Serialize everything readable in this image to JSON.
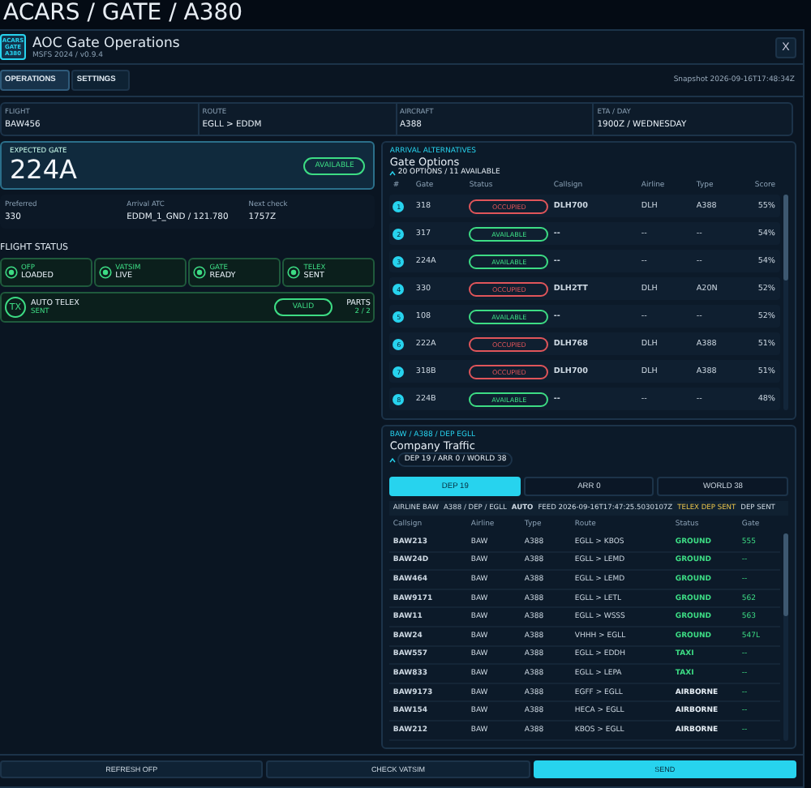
{
  "page_heading": "ACARS / GATE / A380",
  "window": {
    "logo": [
      "ACARS",
      "GATE",
      "A380"
    ],
    "title": "AOC Gate Operations",
    "subtitle": "MSFS 2024 / v0.9.4",
    "close": "X"
  },
  "tabs": [
    {
      "label": "OPERATIONS",
      "selected": true
    },
    {
      "label": "SETTINGS",
      "selected": false
    }
  ],
  "snapshot": "Snapshot 2026-09-16T17:48:34Z",
  "info": [
    {
      "label": "FLIGHT",
      "value": "BAW456"
    },
    {
      "label": "ROUTE",
      "value": "EGLL > EDDM"
    },
    {
      "label": "AIRCRAFT",
      "value": "A388"
    },
    {
      "label": "ETA / DAY",
      "value": "1900Z / WEDNESDAY"
    }
  ],
  "expected_gate": {
    "label": "EXPECTED GATE",
    "gate": "224A",
    "status": "AVAILABLE"
  },
  "details": [
    {
      "label": "Preferred",
      "value": "330"
    },
    {
      "label": "Arrival ATC",
      "value": "EDDM_1_GND / 121.780"
    },
    {
      "label": "Next check",
      "value": "1757Z"
    }
  ],
  "flight_status": {
    "title": "FLIGHT STATUS",
    "items": [
      {
        "label": "OFP",
        "value": "LOADED",
        "ok": true
      },
      {
        "label": "VATSIM",
        "value": "LIVE",
        "ok": true
      },
      {
        "label": "GATE",
        "value": "READY",
        "ok": true
      },
      {
        "label": "TELEX",
        "value": "SENT",
        "ok": true
      }
    ],
    "auto_telex": {
      "icon": "TX",
      "label": "AUTO TELEX",
      "value": "SENT",
      "badge": "VALID",
      "parts_label": "PARTS",
      "parts": "2 / 2"
    }
  },
  "gate_options": {
    "eyebrow": "ARRIVAL ALTERNATIVES",
    "title": "Gate Options",
    "summary": "20 OPTIONS / 11 AVAILABLE",
    "columns": [
      "#",
      "Gate",
      "Status",
      "Callsign",
      "Airline",
      "Type",
      "Score"
    ],
    "rows": [
      {
        "index": "1",
        "gate": "318",
        "kind": "occupied",
        "status": "OCCUPIED",
        "callsign": "DLH700",
        "airline": "DLH",
        "type": "A388",
        "score": "55%"
      },
      {
        "index": "2",
        "gate": "317",
        "kind": "available",
        "status": "AVAILABLE",
        "callsign": "--",
        "airline": "--",
        "type": "--",
        "score": "54%"
      },
      {
        "index": "3",
        "gate": "224A",
        "kind": "available",
        "status": "AVAILABLE",
        "callsign": "--",
        "airline": "--",
        "type": "--",
        "score": "54%"
      },
      {
        "index": "4",
        "gate": "330",
        "kind": "occupied",
        "status": "OCCUPIED",
        "callsign": "DLH2TT",
        "airline": "DLH",
        "type": "A20N",
        "score": "52%"
      },
      {
        "index": "5",
        "gate": "108",
        "kind": "available",
        "status": "AVAILABLE",
        "callsign": "--",
        "airline": "--",
        "type": "--",
        "score": "52%"
      },
      {
        "index": "6",
        "gate": "222A",
        "kind": "occupied",
        "status": "OCCUPIED",
        "callsign": "DLH768",
        "airline": "DLH",
        "type": "A388",
        "score": "51%"
      },
      {
        "index": "7",
        "gate": "318B",
        "kind": "occupied",
        "status": "OCCUPIED",
        "callsign": "DLH700",
        "airline": "DLH",
        "type": "A388",
        "score": "51%"
      },
      {
        "index": "8",
        "gate": "224B",
        "kind": "available",
        "status": "AVAILABLE",
        "callsign": "--",
        "airline": "--",
        "type": "--",
        "score": "48%"
      }
    ]
  },
  "company_traffic": {
    "eyebrow": "BAW / A388 / DEP EGLL",
    "title": "Company Traffic",
    "summary": "DEP 19 / ARR 0 / WORLD 38",
    "tabs": [
      {
        "label": "DEP 19",
        "selected": true
      },
      {
        "label": "ARR 0",
        "selected": false
      },
      {
        "label": "WORLD 38",
        "selected": false
      }
    ],
    "meta": [
      {
        "text": "AIRLINE BAW",
        "kind": "plain"
      },
      {
        "text": "A388 / DEP / EGLL",
        "kind": "plain"
      },
      {
        "text": "AUTO",
        "kind": "bold"
      },
      {
        "text": "FEED 2026-09-16T17:47:25.5030107Z",
        "kind": "plain"
      },
      {
        "text": "TELEX DEP SENT",
        "kind": "warn"
      },
      {
        "text": "DEP SENT",
        "kind": "plain"
      }
    ],
    "columns": [
      "Callsign",
      "Airline",
      "Type",
      "Route",
      "Status",
      "Gate"
    ],
    "rows": [
      {
        "callsign": "BAW213",
        "airline": "BAW",
        "type": "A388",
        "route": "EGLL > KBOS",
        "kind": "ground",
        "status": "GROUND",
        "gate": "555"
      },
      {
        "callsign": "BAW24D",
        "airline": "BAW",
        "type": "A388",
        "route": "EGLL > LEMD",
        "kind": "ground",
        "status": "GROUND",
        "gate": "--"
      },
      {
        "callsign": "BAW464",
        "airline": "BAW",
        "type": "A388",
        "route": "EGLL > LEMD",
        "kind": "ground",
        "status": "GROUND",
        "gate": "--"
      },
      {
        "callsign": "BAW9171",
        "airline": "BAW",
        "type": "A388",
        "route": "EGLL > LETL",
        "kind": "ground",
        "status": "GROUND",
        "gate": "562"
      },
      {
        "callsign": "BAW11",
        "airline": "BAW",
        "type": "A388",
        "route": "EGLL > WSSS",
        "kind": "ground",
        "status": "GROUND",
        "gate": "563"
      },
      {
        "callsign": "BAW24",
        "airline": "BAW",
        "type": "A388",
        "route": "VHHH > EGLL",
        "kind": "ground",
        "status": "GROUND",
        "gate": "547L"
      },
      {
        "callsign": "BAW557",
        "airline": "BAW",
        "type": "A388",
        "route": "EGLL > EDDH",
        "kind": "taxi",
        "status": "TAXI",
        "gate": "--"
      },
      {
        "callsign": "BAW833",
        "airline": "BAW",
        "type": "A388",
        "route": "EGLL > LEPA",
        "kind": "taxi",
        "status": "TAXI",
        "gate": "--"
      },
      {
        "callsign": "BAW9173",
        "airline": "BAW",
        "type": "A388",
        "route": "EGFF > EGLL",
        "kind": "airborne",
        "status": "AIRBORNE",
        "gate": "--"
      },
      {
        "callsign": "BAW154",
        "airline": "BAW",
        "type": "A388",
        "route": "HECA > EGLL",
        "kind": "airborne",
        "status": "AIRBORNE",
        "gate": "--"
      },
      {
        "callsign": "BAW212",
        "airline": "BAW",
        "type": "A388",
        "route": "KBOS > EGLL",
        "kind": "airborne",
        "status": "AIRBORNE",
        "gate": "--"
      }
    ]
  },
  "actions": [
    {
      "label": "REFRESH OFP",
      "primary": false
    },
    {
      "label": "CHECK VATSIM",
      "primary": false
    },
    {
      "label": "SEND",
      "primary": true
    }
  ]
}
